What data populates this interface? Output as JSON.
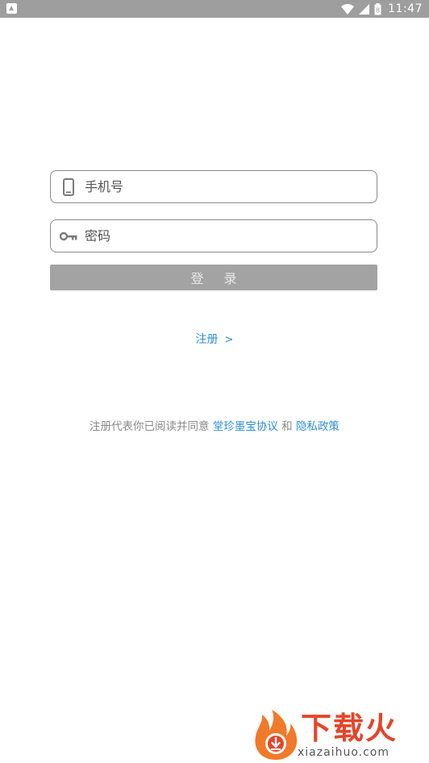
{
  "status_bar": {
    "time": "11:47",
    "battery_level": "8"
  },
  "login": {
    "phone_placeholder": "手机号",
    "password_placeholder": "密码",
    "login_button_label": "登 录",
    "register_label": "注册",
    "register_arrow": ">"
  },
  "agreement": {
    "prefix": "注册代表你已阅读并同意",
    "terms_link": "堂珍墨宝协议",
    "conjunction": "和",
    "privacy_link": "隐私政策"
  },
  "watermark": {
    "title": "下载火",
    "url": "xiazaihuo.com"
  },
  "colors": {
    "status_bar": "#9e9e9e",
    "link": "#2f8fd6",
    "button_disabled": "#a3a3a3",
    "watermark_accent": "#e5452a"
  }
}
